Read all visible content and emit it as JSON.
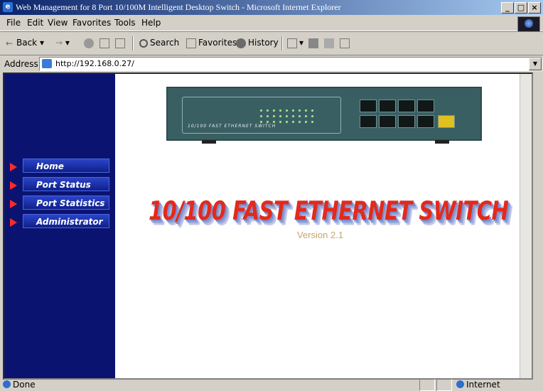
{
  "window": {
    "title": "Web Management for 8 Port 10/100M Intelligent Desktop Switch - Microsoft Internet Explorer",
    "buttons": [
      "_",
      "т",
      "x"
    ]
  },
  "menu": [
    {
      "label": "File"
    },
    {
      "label": "Edit"
    },
    {
      "label": "View"
    },
    {
      "label": "Favorites"
    },
    {
      "label": "Tools"
    },
    {
      "label": "Help"
    }
  ],
  "toolbar": {
    "back_label": "Back",
    "search_label": "Search",
    "favorites_label": "Favorites",
    "history_label": "History"
  },
  "address": {
    "label": "Address",
    "url": "http://192.168.0.27/"
  },
  "sidebar": {
    "items": [
      {
        "label": "Home"
      },
      {
        "label": "Port Status"
      },
      {
        "label": "Port Statistics"
      },
      {
        "label": "Administrator"
      }
    ]
  },
  "device": {
    "brand_text": "10/100 FAST ETHERNET SWITCH"
  },
  "main": {
    "banner": "10/100 FAST ETHERNET SWITCH",
    "version": "Version 2.1"
  },
  "status": {
    "text": "Done",
    "zone": "Internet"
  },
  "colors": {
    "sidebar_bg": "#0a1470",
    "nav_arrow": "#ff2a2a",
    "banner_red": "#e22a1c",
    "version_text": "#c8a46a"
  }
}
